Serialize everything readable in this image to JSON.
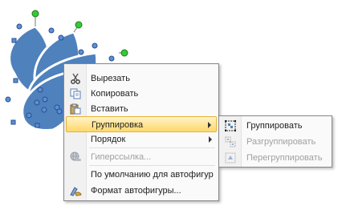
{
  "context_menu": {
    "items": [
      {
        "label": "Вырезать",
        "icon": "scissors-icon",
        "enabled": true
      },
      {
        "label": "Копировать",
        "icon": "copy-icon",
        "enabled": true
      },
      {
        "label": "Вставить",
        "icon": "paste-icon",
        "enabled": true
      },
      {
        "label": "Группировка",
        "icon": "",
        "enabled": true,
        "highlighted": true,
        "has_submenu": true
      },
      {
        "label": "Порядок",
        "icon": "",
        "enabled": true,
        "has_submenu": true
      },
      {
        "label": "Гиперссылка...",
        "icon": "hyperlink-icon",
        "enabled": false
      },
      {
        "label": "По умолчанию для автофигур",
        "icon": "",
        "enabled": true
      },
      {
        "label": "Формат автофигуры...",
        "icon": "format-shape-icon",
        "enabled": true
      }
    ]
  },
  "submenu": {
    "items": [
      {
        "label": "Группировать",
        "icon": "group-icon",
        "enabled": true
      },
      {
        "label": "Разгруппировать",
        "icon": "ungroup-icon",
        "enabled": false
      },
      {
        "label": "Перегруппировать",
        "icon": "regroup-icon",
        "enabled": false
      }
    ]
  },
  "colors": {
    "shape_fill": "#4f81bd",
    "shape_outline": "#ffffff",
    "handle_fill": "#5b8fd6",
    "rotation_handle": "#33cc33",
    "highlight_top": "#fff3c7",
    "highlight_bottom": "#ffd86b"
  }
}
